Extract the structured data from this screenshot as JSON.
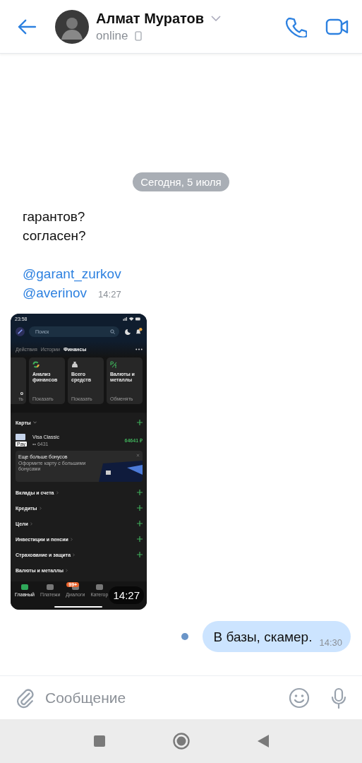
{
  "header": {
    "name": "Алмат Муратов",
    "status": "online"
  },
  "date_divider": "Сегодня, 5 июля",
  "messages": [
    {
      "kind": "incoming_text",
      "paragraphs": [
        [
          {
            "kind": "plain",
            "text": "гарантов?"
          },
          {
            "kind": "plain",
            "text": "согласен?"
          }
        ],
        [
          {
            "kind": "mention",
            "text": "@garant_zurkov"
          },
          {
            "kind": "mention",
            "text": "@averinov"
          }
        ]
      ],
      "time": "14:27"
    },
    {
      "kind": "screenshot",
      "time": "14:27",
      "screen": {
        "status_time": "23:58",
        "search_placeholder": "Поиск",
        "tabs": [
          {
            "label": "Действия",
            "selected": false
          },
          {
            "label": "Истории",
            "selected": false
          },
          {
            "label": "Финансы",
            "selected": true
          }
        ],
        "tiles": [
          {
            "kind": "cut",
            "title": "о",
            "subtitle": "ть"
          },
          {
            "kind": "chart",
            "title": "Анализ финансов",
            "subtitle": "Показать"
          },
          {
            "kind": "bag",
            "title": "Всего средств",
            "subtitle": "Показать"
          },
          {
            "kind": "currency",
            "title": "Валюты и металлы",
            "subtitle": "Обменять"
          }
        ],
        "cards_section": {
          "title": "Карты",
          "card": {
            "name": "Visa Classic",
            "number": "•• 6431",
            "amount": "64641 ₽",
            "pay": "Pay"
          }
        },
        "promo": {
          "title": "Еще больше бонусов",
          "text": "Оформите карту с большими бонусами"
        },
        "sections": [
          {
            "title": "Вклады и счета"
          },
          {
            "title": "Кредиты"
          },
          {
            "title": "Цели"
          },
          {
            "title": "Инвестиции и пенсии"
          },
          {
            "title": "Страхование и защита"
          },
          {
            "title": "Валюты и металлы"
          }
        ],
        "nav": [
          {
            "label": "Главный",
            "selected": true
          },
          {
            "label": "Платежи",
            "selected": false
          },
          {
            "label": "Диалоги",
            "selected": false,
            "badge": "99+"
          },
          {
            "label": "Категор",
            "selected": false
          }
        ]
      }
    },
    {
      "kind": "outgoing_text",
      "unread": true,
      "paragraphs": [
        [
          {
            "kind": "plain",
            "text": "В базы, скамер."
          }
        ]
      ],
      "time": "14:30"
    }
  ],
  "composer": {
    "placeholder": "Сообщение"
  }
}
